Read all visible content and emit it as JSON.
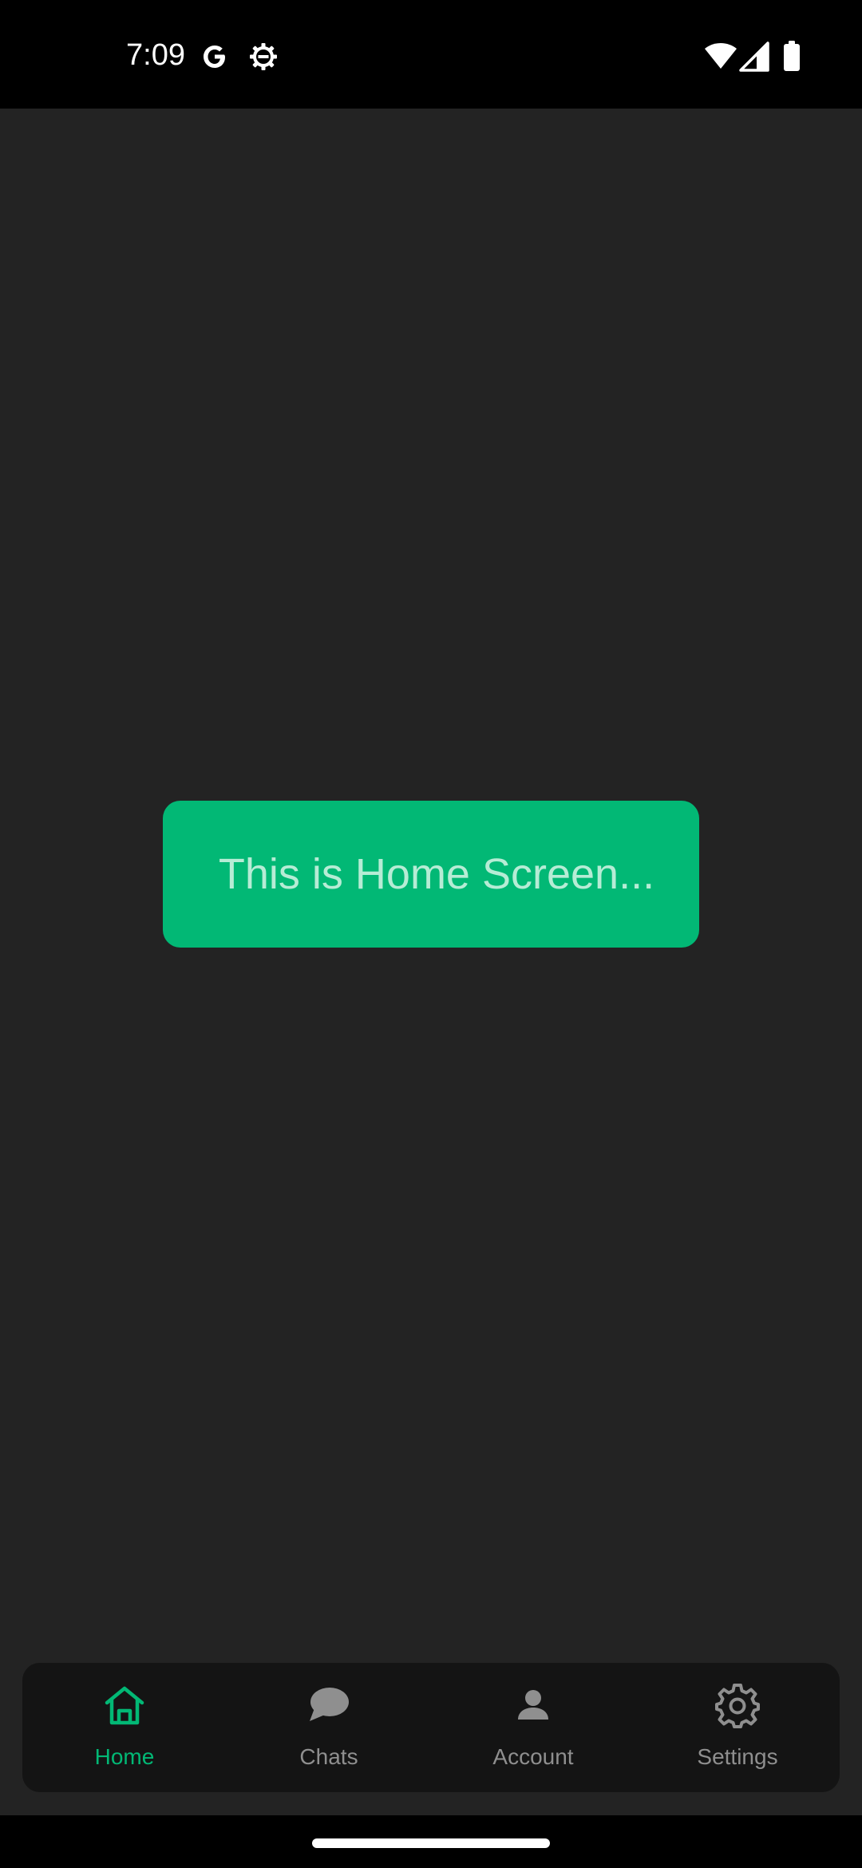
{
  "status_bar": {
    "time": "7:09",
    "left_icons": [
      "google-icon",
      "settings-gear-icon"
    ],
    "right_icons": [
      "wifi-icon",
      "cellular-signal-icon",
      "battery-icon"
    ]
  },
  "main": {
    "card_text": "This is Home Screen..."
  },
  "bottom_nav": {
    "items": [
      {
        "label": "Home",
        "icon": "home-icon",
        "active": true
      },
      {
        "label": "Chats",
        "icon": "chat-bubble-icon",
        "active": false
      },
      {
        "label": "Account",
        "icon": "person-icon",
        "active": false
      },
      {
        "label": "Settings",
        "icon": "gear-icon",
        "active": false
      }
    ]
  },
  "colors": {
    "accent": "#02b875",
    "background": "#232323",
    "nav_background": "#141414",
    "inactive": "#8f8f8f"
  }
}
